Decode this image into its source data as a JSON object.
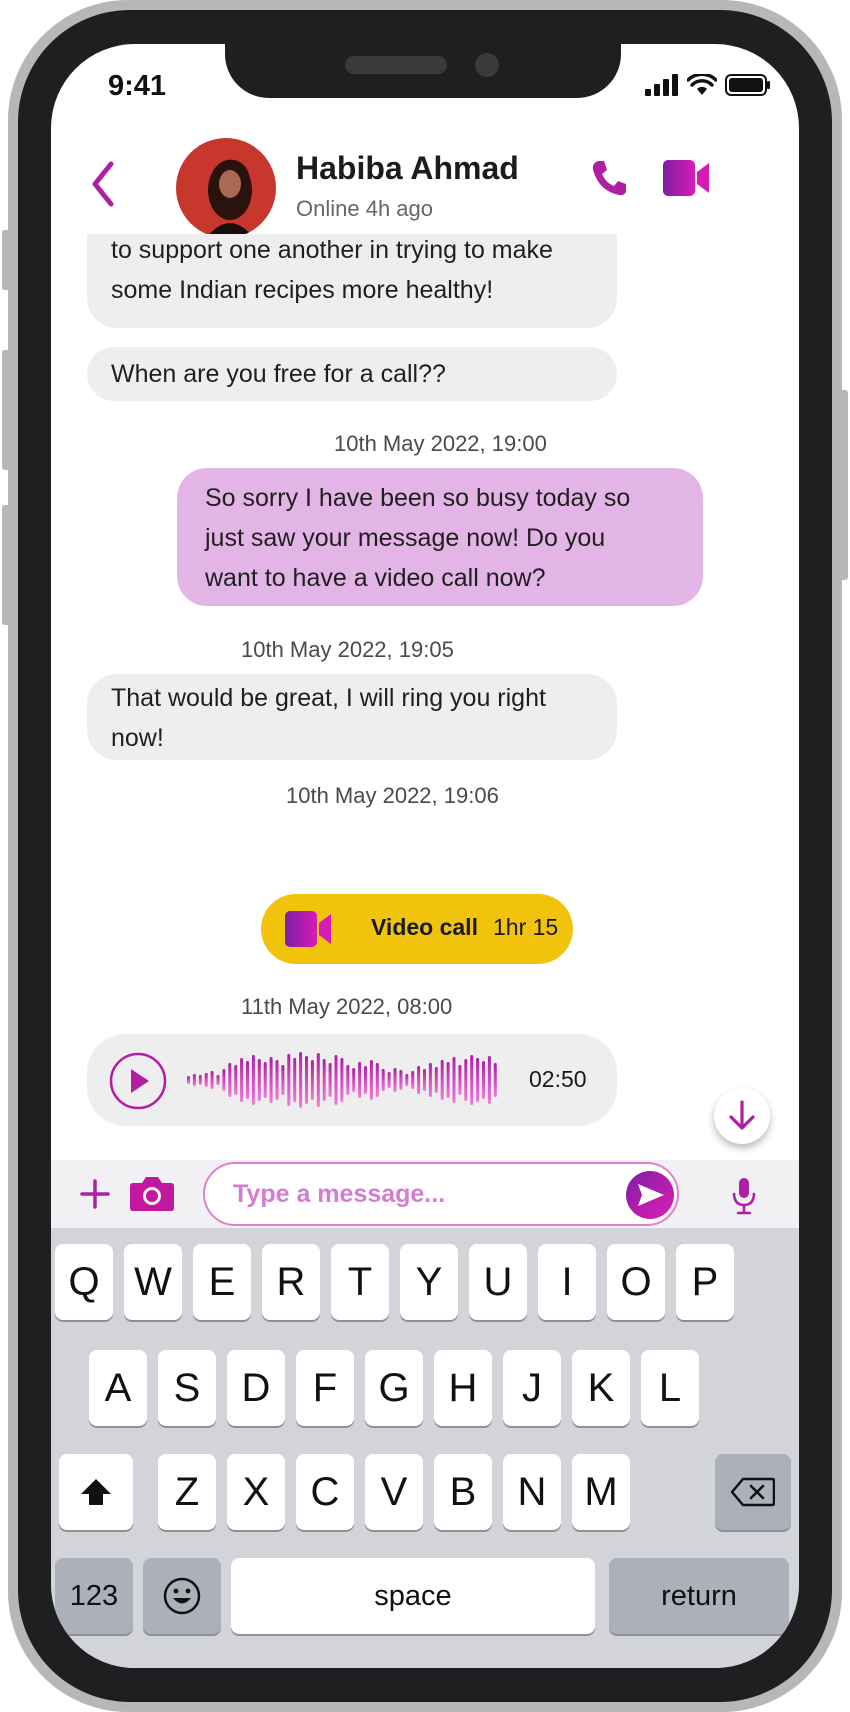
{
  "status_bar": {
    "time": "9:41"
  },
  "contact": {
    "name": "Habiba Ahmad",
    "status": "Online 4h ago"
  },
  "messages": {
    "m1_line1": "to support one another in trying to make",
    "m1_line2": "some Indian recipes more healthy!",
    "m2": "When are you free for a call??",
    "ts1": "10th May 2022, 19:00",
    "m3_line1": "So sorry I have been so busy today so",
    "m3_line2": "just saw your message now! Do you",
    "m3_line3": "want to have a video call now?",
    "ts2": "10th May 2022, 19:05",
    "m4_line1": "That would be great, I will ring you right",
    "m4_line2": "now!",
    "ts3": "10th May 2022, 19:06",
    "video_call_label": "Video call",
    "video_call_duration": "1hr 15",
    "ts4": "11th May 2022, 08:00",
    "voice_duration": "02:50"
  },
  "composer": {
    "placeholder": "Type a message..."
  },
  "keyboard": {
    "row1": [
      "Q",
      "W",
      "E",
      "R",
      "T",
      "Y",
      "U",
      "I",
      "O",
      "P"
    ],
    "row2": [
      "A",
      "S",
      "D",
      "F",
      "G",
      "H",
      "J",
      "K",
      "L"
    ],
    "row3": [
      "Z",
      "X",
      "C",
      "V",
      "B",
      "N",
      "M"
    ],
    "numbers": "123",
    "space": "space",
    "return": "return"
  },
  "colors": {
    "accent": "#b01fa3",
    "outgoing_bubble": "#e3b4e6",
    "incoming_bubble": "#eeeeee",
    "video_pill": "#f2c30d"
  },
  "icons": [
    "back-chevron-icon",
    "phone-icon",
    "video-camera-icon",
    "play-icon",
    "scroll-down-arrow-icon",
    "plus-icon",
    "camera-icon",
    "send-icon",
    "microphone-icon",
    "shift-icon",
    "backspace-icon",
    "emoji-icon"
  ]
}
